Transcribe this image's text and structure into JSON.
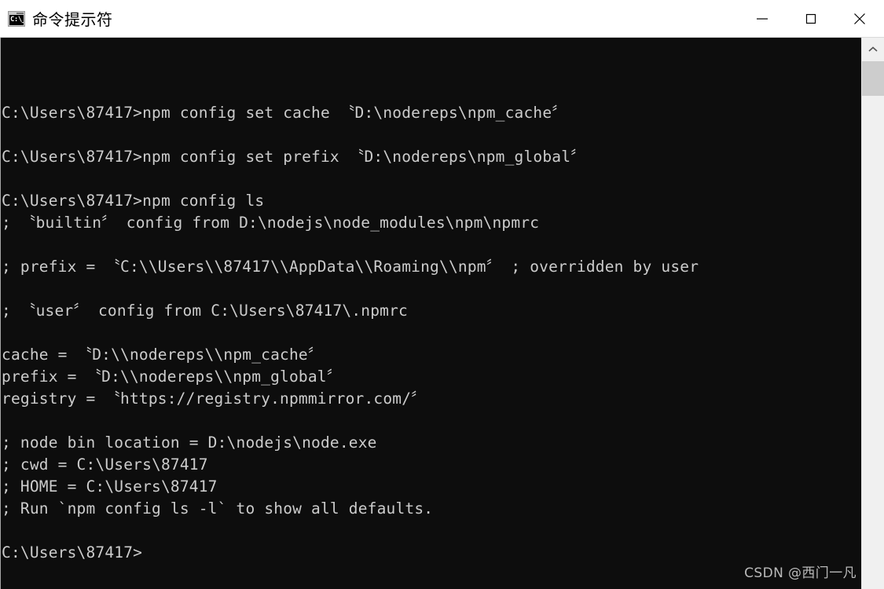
{
  "window": {
    "title": "命令提示符",
    "icon_name": "cmd-prompt-icon",
    "icon_text": "C:\\_",
    "controls": {
      "minimize_label": "—",
      "maximize_label": "□",
      "close_label": "✕"
    }
  },
  "console": {
    "background_color": "#0d0d0d",
    "text_color": "#cccccc",
    "lines": [
      "C:\\Users\\87417>npm config set cache 〝D:\\nodereps\\npm_cache〞",
      "",
      "C:\\Users\\87417>npm config set prefix 〝D:\\nodereps\\npm_global〞",
      "",
      "C:\\Users\\87417>npm config ls",
      "; 〝builtin〞 config from D:\\nodejs\\node_modules\\npm\\npmrc",
      "",
      "; prefix = 〝C:\\\\Users\\\\87417\\\\AppData\\\\Roaming\\\\npm〞 ; overridden by user",
      "",
      "; 〝user〞 config from C:\\Users\\87417\\.npmrc",
      "",
      "cache = 〝D:\\\\nodereps\\\\npm_cache〞",
      "prefix = 〝D:\\\\nodereps\\\\npm_global〞",
      "registry = 〝https://registry.npmmirror.com/〞",
      "",
      "; node bin location = D:\\nodejs\\node.exe",
      "; cwd = C:\\Users\\87417",
      "; HOME = C:\\Users\\87417",
      "; Run `npm config ls -l` to show all defaults.",
      "",
      "C:\\Users\\87417>"
    ]
  },
  "scrollbar": {
    "up_arrow_icon": "chevron-up-icon"
  },
  "watermark": {
    "text": "CSDN @西门一凡"
  }
}
